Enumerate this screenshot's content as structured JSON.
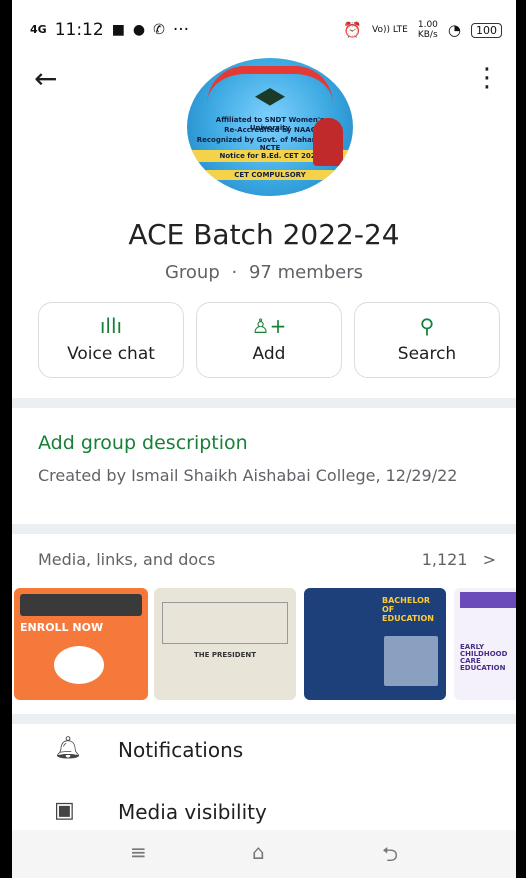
{
  "status_bar": {
    "network": "4G",
    "time": "11:12",
    "more_indicator": "···",
    "volte": "Vo)) LTE",
    "speed_value": "1.00",
    "speed_unit": "KB/s",
    "battery": "100"
  },
  "header": {
    "back_icon": "arrow-left-icon",
    "more_icon": "more-vert-icon"
  },
  "group_avatar": {
    "text_lines": [
      "Affiliated to SNDT Women's University",
      "Re-Accredited by NAAC",
      "Recognized by Govt. of Maharashtra, NCTE",
      "Notice for B.Ed. CET 2022",
      "CET COMPULSORY"
    ]
  },
  "group": {
    "name": "ACE Batch 2022-24",
    "type": "Group",
    "separator": "·",
    "members": "97 members"
  },
  "actions": [
    {
      "label": "Voice chat",
      "icon": "voice-chat-icon"
    },
    {
      "label": "Add",
      "icon": "add-person-icon"
    },
    {
      "label": "Search",
      "icon": "search-icon"
    }
  ],
  "description": {
    "link": "Add group description",
    "created": "Created by Ismail Shaikh Aishabai College, 12/29/22"
  },
  "media": {
    "label": "Media, links, and docs",
    "count": "1,121",
    "chevron": ">",
    "thumbnails": [
      {
        "heading": "ENROLL NOW",
        "bg": "#f4793b"
      },
      {
        "heading": "THE PRESIDENT",
        "bg": "#e8e4d8"
      },
      {
        "heading": "BACHELOR OF EDUCATION",
        "bg": "#1d3f7a"
      },
      {
        "heading": "EARLY CHILDHOOD CARE EDUCATION",
        "bg": "#f4f1fa"
      }
    ]
  },
  "settings": [
    {
      "label": "Notifications",
      "icon": "bell-icon"
    },
    {
      "label": "Media visibility",
      "icon": "image-icon"
    }
  ],
  "nav": {
    "recents": "≡",
    "home": "⌂",
    "back": "⮌"
  },
  "colors": {
    "accent": "#188038",
    "divider": "#eceff1"
  }
}
